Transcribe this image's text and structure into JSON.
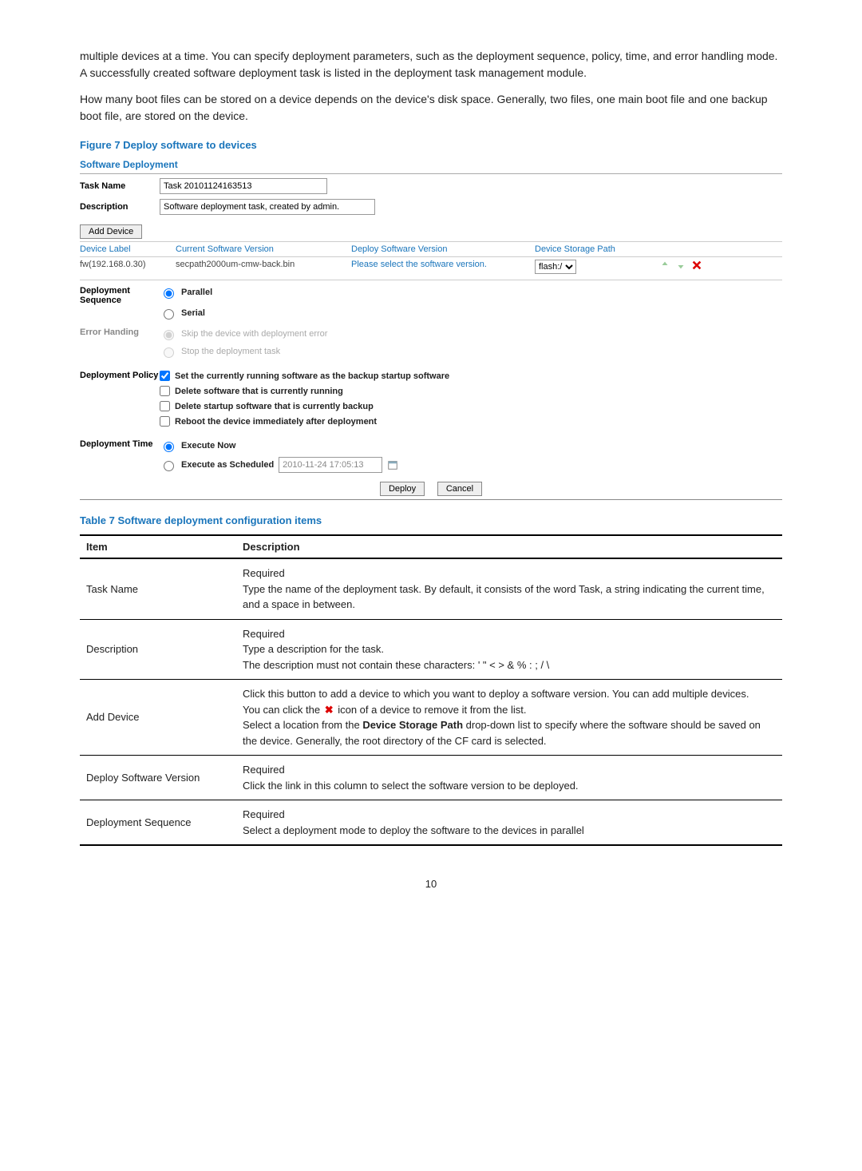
{
  "intro": {
    "p1": "multiple devices at a time. You can specify deployment parameters, such as the deployment sequence, policy, time, and error handling mode. A successfully created software deployment task is listed in the deployment task management module.",
    "p2": "How many boot files can be stored on a device depends on the device's disk space. Generally, two files, one main boot file and one backup boot file, are stored on the device."
  },
  "figure_caption": "Figure 7 Deploy software to devices",
  "shot": {
    "title": "Software Deployment",
    "task_name_label": "Task Name",
    "task_name_value": "Task 20101124163513",
    "description_label": "Description",
    "description_value": "Software deployment task, created by admin.",
    "add_device_btn": "Add Device",
    "grid": {
      "h1": "Device Label",
      "h2": "Current Software Version",
      "h3": "Deploy Software Version",
      "h4": "Device Storage Path",
      "r_label": "fw(192.168.0.30)",
      "r_ver": "secpath2000um-cmw-back.bin",
      "r_dep": "Please select the software version.",
      "r_path": "flash:/"
    },
    "dep_seq_label": "Deployment Sequence",
    "seq_parallel": "Parallel",
    "seq_serial": "Serial",
    "err_label": "Error Handing",
    "err_skip": "Skip the device with deployment error",
    "err_stop": "Stop the deployment task",
    "policy_label": "Deployment Policy",
    "pol1": "Set the currently running software as the backup startup software",
    "pol2": "Delete software that is currently running",
    "pol3": "Delete startup software that is currently backup",
    "pol4": "Reboot the device immediately after deployment",
    "time_label": "Deployment Time",
    "time_now": "Execute Now",
    "time_sched": "Execute as Scheduled",
    "time_value": "2010-11-24 17:05:13",
    "deploy_btn": "Deploy",
    "cancel_btn": "Cancel"
  },
  "table_caption": "Table 7 Software deployment configuration items",
  "t7": {
    "h_item": "Item",
    "h_desc": "Description",
    "r1_item": "Task Name",
    "r1_req": "Required",
    "r1_desc": "Type the name of the deployment task. By default, it consists of the word Task, a string indicating the current time, and a space in between.",
    "r2_item": "Description",
    "r2_req": "Required",
    "r2_a": "Type a description for the task.",
    "r2_b": "The description must not contain these characters: ' \" < > & % : ; / \\",
    "r3_item": "Add Device",
    "r3_a": "Click this button to add a device to which you want to deploy a software version. You can add multiple devices.",
    "r3_b_pre": "You can click the ",
    "r3_b_post": " icon of a device to remove it from the list.",
    "r3_c_pre": "Select a location from the ",
    "r3_c_bold": "Device Storage Path",
    "r3_c_post": " drop-down list to specify where the software should be saved on the device. Generally, the root directory of the CF card is selected.",
    "r4_item": "Deploy Software Version",
    "r4_req": "Required",
    "r4_desc": "Click the link in this column to select the software version to be deployed.",
    "r5_item": "Deployment Sequence",
    "r5_req": "Required",
    "r5_desc": "Select a deployment mode to deploy the software to the devices in parallel"
  },
  "page_number": "10"
}
